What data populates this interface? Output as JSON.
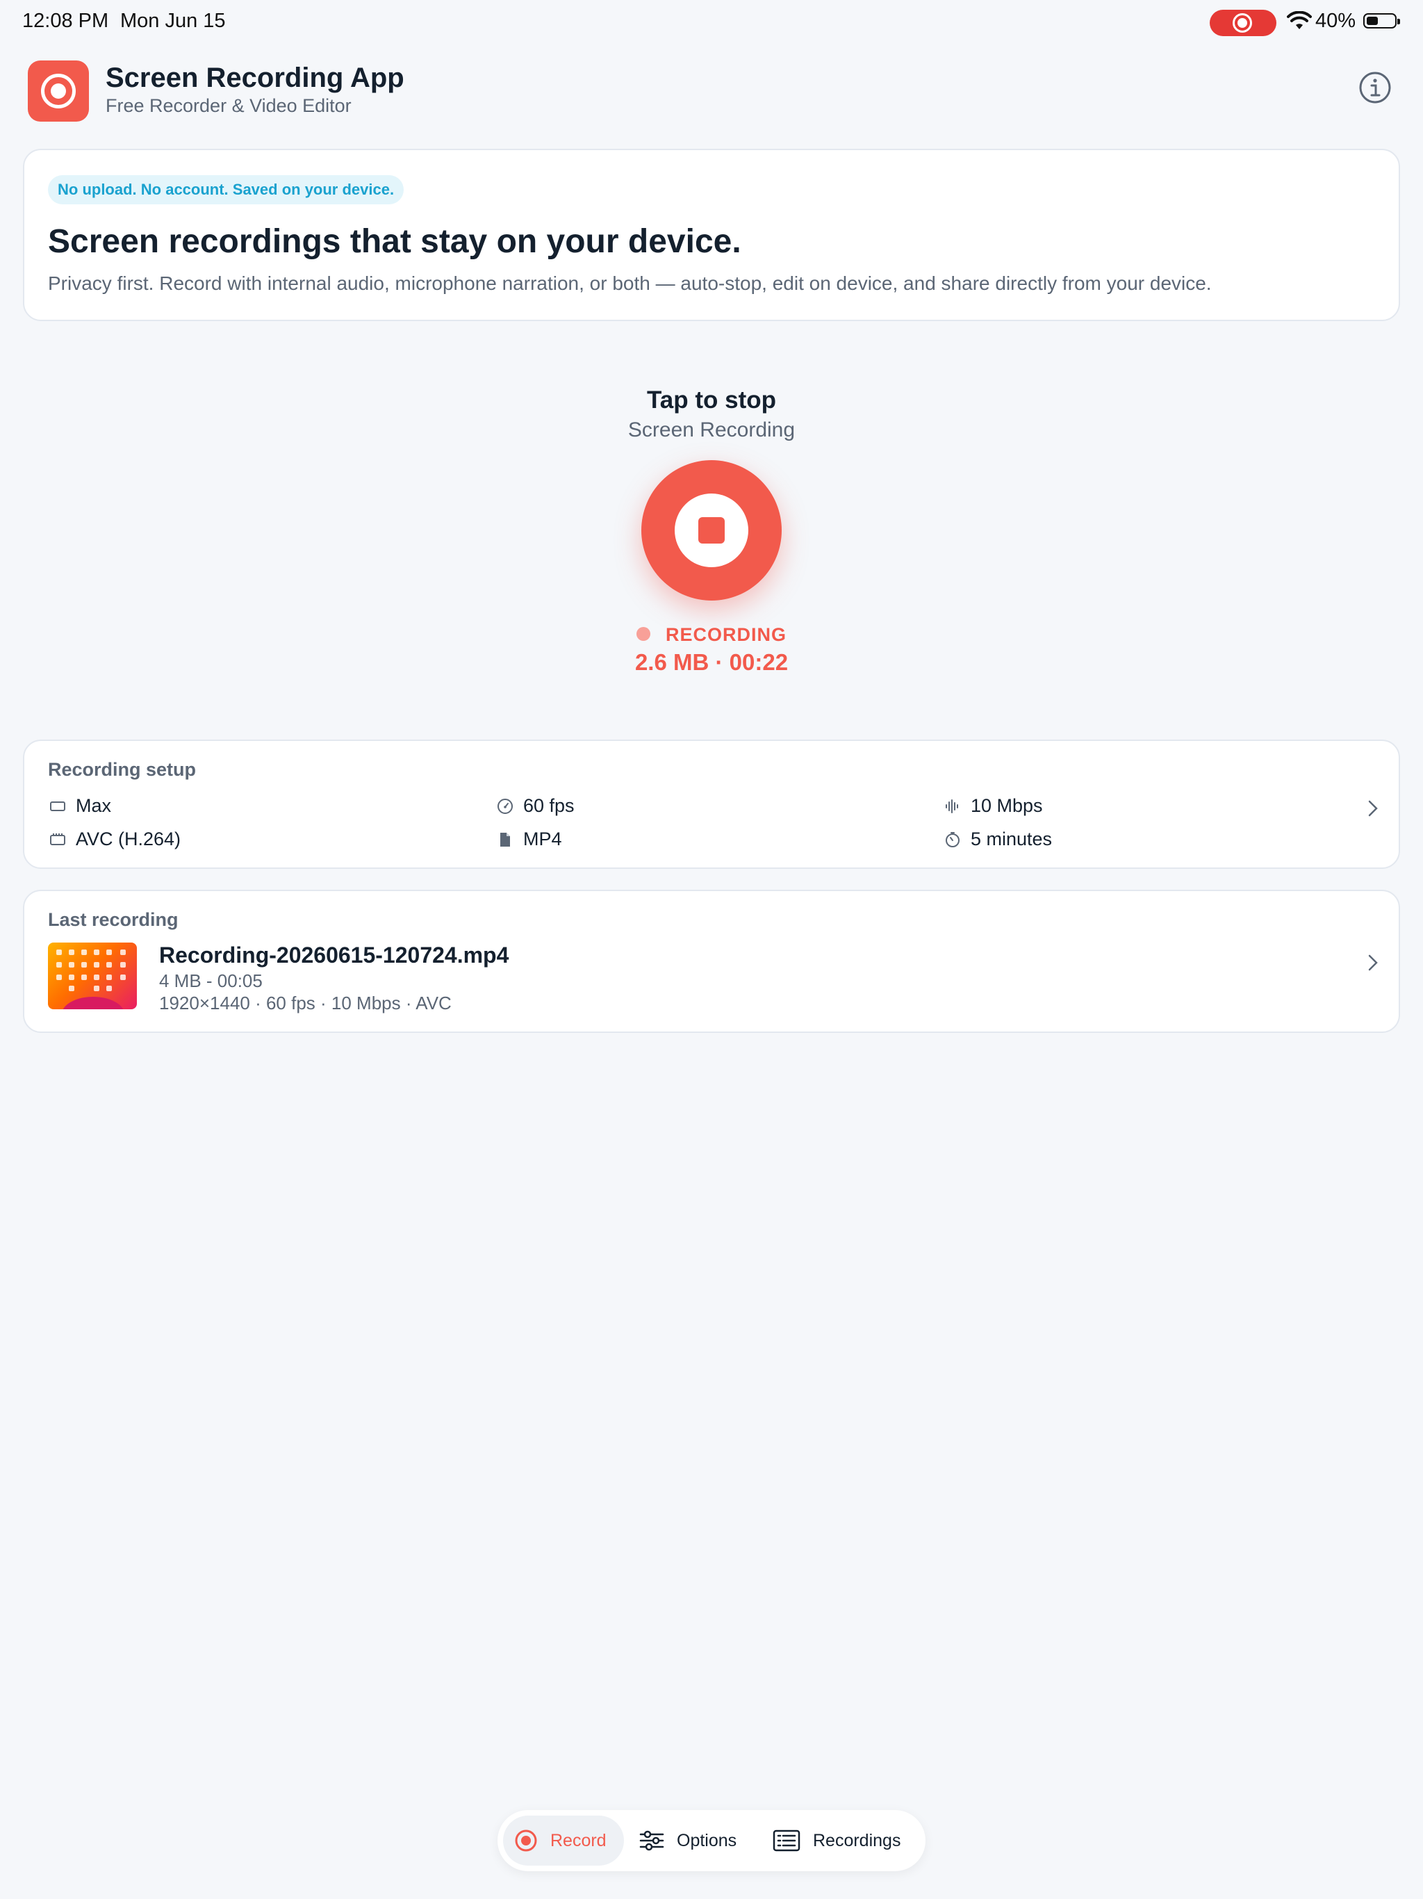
{
  "status_bar": {
    "time": "12:08 PM",
    "date": "Mon Jun 15",
    "battery": "40%"
  },
  "header": {
    "title": "Screen Recording App",
    "subtitle": "Free Recorder & Video Editor"
  },
  "hero": {
    "badge": "No upload. No account. Saved on your device.",
    "title": "Screen recordings that stay on your device.",
    "body": "Privacy first. Record with internal audio, microphone narration, or both — auto-stop, edit on device, and share directly from your device."
  },
  "recorder": {
    "title": "Tap to stop",
    "subtitle": "Screen Recording",
    "state": "RECORDING",
    "stats": "2.6 MB · 00:22"
  },
  "setup": {
    "label": "Recording setup",
    "resolution": "Max",
    "codec": "AVC (H.264)",
    "fps": "60 fps",
    "format": "MP4",
    "bitrate": "10 Mbps",
    "duration": "5 minutes"
  },
  "last_recording": {
    "label": "Last recording",
    "filename": "Recording-20260615-120724.mp4",
    "meta1": "4 MB - 00:05",
    "meta2": "1920×1440 · 60 fps · 10 Mbps · AVC"
  },
  "tabs": {
    "record": "Record",
    "options": "Options",
    "recordings": "Recordings"
  },
  "colors": {
    "accent": "#f25a4c",
    "badge_text": "#1aa2cf",
    "background": "#f5f7fa"
  }
}
